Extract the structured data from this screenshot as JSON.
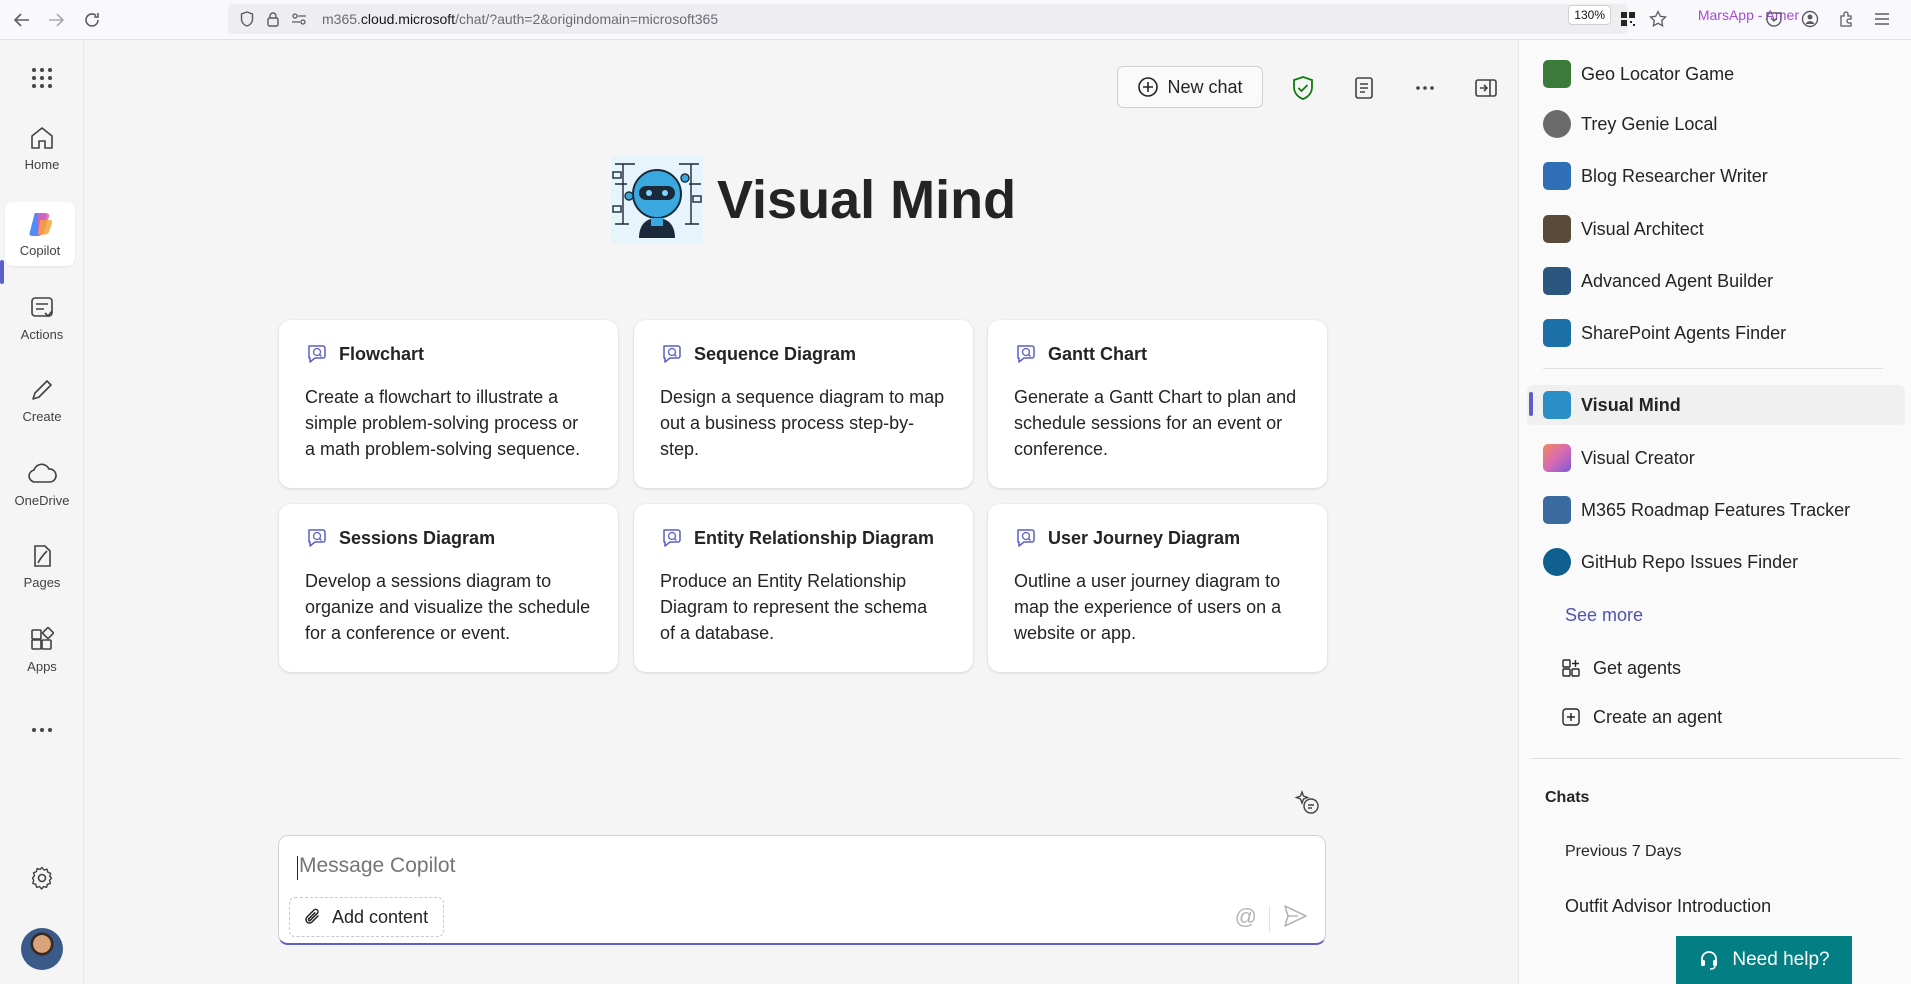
{
  "browser": {
    "url_prefix": "m365.",
    "url_host": "cloud.microsoft",
    "url_path": "/chat/?auth=2&origindomain=microsoft365",
    "profile_label": "MarsApp - Amer",
    "zoom": "130%"
  },
  "rail": {
    "items": [
      {
        "label": "Home"
      },
      {
        "label": "Copilot"
      },
      {
        "label": "Actions"
      },
      {
        "label": "Create"
      },
      {
        "label": "OneDrive"
      },
      {
        "label": "Pages"
      },
      {
        "label": "Apps"
      }
    ]
  },
  "toolbar": {
    "new_chat_label": "New chat"
  },
  "hero": {
    "title": "Visual Mind"
  },
  "cards": [
    {
      "title": "Flowchart",
      "desc": "Create a flowchart to illustrate a simple problem-solving process or a math problem-solving sequence."
    },
    {
      "title": "Sequence Diagram",
      "desc": "Design a sequence diagram to map out a business process step-by-step."
    },
    {
      "title": "Gantt Chart",
      "desc": "Generate a Gantt Chart to plan and schedule sessions for an event or conference."
    },
    {
      "title": "Sessions Diagram",
      "desc": "Develop a sessions diagram to organize and visualize the schedule for a conference or event."
    },
    {
      "title": "Entity Relationship Diagram",
      "desc": "Produce an Entity Relationship Diagram to represent the schema of a database."
    },
    {
      "title": "User Journey Diagram",
      "desc": "Outline a user journey diagram to map the experience of users on a website or app."
    }
  ],
  "composer": {
    "placeholder": "Message Copilot",
    "add_content_label": "Add content"
  },
  "panel": {
    "agents": [
      {
        "label": "Geo Locator Game",
        "color": "#3b7a3a"
      },
      {
        "label": "Trey Genie Local",
        "color": "#6b6b6b"
      },
      {
        "label": "Blog Researcher Writer",
        "color": "#2f6fb5"
      },
      {
        "label": "Visual Architect",
        "color": "#5a4a3a"
      },
      {
        "label": "Advanced Agent Builder",
        "color": "#2a5680"
      },
      {
        "label": "SharePoint Agents Finder",
        "color": "#1d6fa8"
      }
    ],
    "active_agent": {
      "label": "Visual Mind",
      "color": "#2b8fc7"
    },
    "more_agents": [
      {
        "label": "Visual Creator",
        "color": "#d86ab3"
      },
      {
        "label": "M365 Roadmap Features Tracker",
        "color": "#3a6b9e"
      },
      {
        "label": "GitHub Repo Issues Finder",
        "color": "#0f5f8f"
      }
    ],
    "see_more": "See more",
    "get_agents": "Get agents",
    "create_agent": "Create an agent",
    "chats_heading": "Chats",
    "chats_section": "Previous 7 Days",
    "chats": [
      "Outfit Advisor Introduction"
    ],
    "need_help": "Need help?"
  },
  "colors": {
    "accent": "#5b5fc7",
    "help_bg": "#037f84",
    "link": "#4f52b2"
  }
}
